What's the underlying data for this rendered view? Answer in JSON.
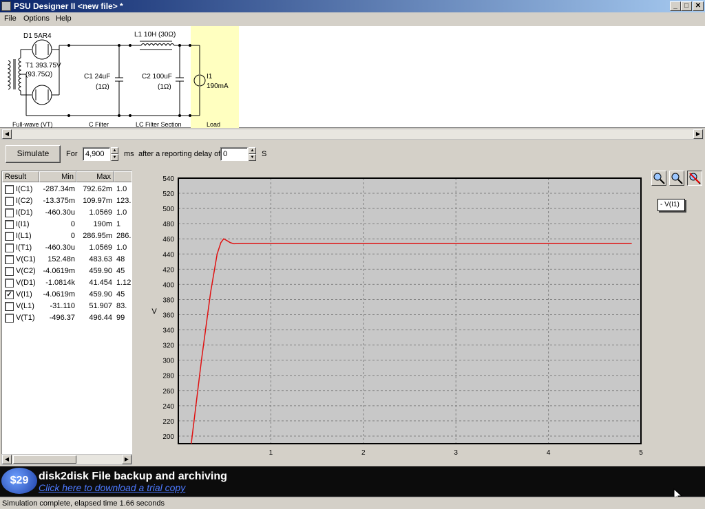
{
  "window": {
    "title": "PSU Designer II  <new file> *",
    "caption_buttons": {
      "minimize": "_",
      "maximize": "□",
      "close": "✕"
    }
  },
  "menu": {
    "items": [
      "File",
      "Options",
      "Help"
    ]
  },
  "schematic": {
    "d1": "D1 5AR4",
    "t1_a": "T1 393.75V",
    "t1_b": "(93.75Ω)",
    "l1": "L1 10H (30Ω)",
    "c1_a": "C1 24uF",
    "c1_b": "(1Ω)",
    "c2_a": "C2 100uF",
    "c2_b": "(1Ω)",
    "i1_a": "I1",
    "i1_b": "190mA",
    "sections": [
      "Full-wave (VT)",
      "C Filter",
      "LC Filter Section",
      "Load"
    ],
    "load_highlight": "#ffffc0"
  },
  "controls": {
    "simulate_label": "Simulate",
    "for_label": "For",
    "duration_value": "4,900",
    "duration_unit": "ms",
    "delay_label": "after a reporting delay of",
    "delay_value": "0",
    "delay_unit": "S"
  },
  "results": {
    "headers": [
      "Result",
      "Min",
      "Max"
    ],
    "rows": [
      {
        "name": "I(C1)",
        "min": "-287.34m",
        "max": "792.62m",
        "extra": "1.0",
        "checked": false
      },
      {
        "name": "I(C2)",
        "min": "-13.375m",
        "max": "109.97m",
        "extra": "123.",
        "checked": false
      },
      {
        "name": "I(D1)",
        "min": "-460.30u",
        "max": "1.0569",
        "extra": "1.0",
        "checked": false
      },
      {
        "name": "I(I1)",
        "min": "0",
        "max": "190m",
        "extra": "1",
        "checked": false
      },
      {
        "name": "I(L1)",
        "min": "0",
        "max": "286.95m",
        "extra": "286.",
        "checked": false
      },
      {
        "name": "I(T1)",
        "min": "-460.30u",
        "max": "1.0569",
        "extra": "1.0",
        "checked": false
      },
      {
        "name": "V(C1)",
        "min": "152.48n",
        "max": "483.63",
        "extra": "48",
        "checked": false
      },
      {
        "name": "V(C2)",
        "min": "-4.0619m",
        "max": "459.90",
        "extra": "45",
        "checked": false
      },
      {
        "name": "V(D1)",
        "min": "-1.0814k",
        "max": "41.454",
        "extra": "1.12",
        "checked": false
      },
      {
        "name": "V(I1)",
        "min": "-4.0619m",
        "max": "459.90",
        "extra": "45",
        "checked": true
      },
      {
        "name": "V(L1)",
        "min": "-31.110",
        "max": "51.907",
        "extra": "83.",
        "checked": false
      },
      {
        "name": "V(T1)",
        "min": "-496.37",
        "max": "496.44",
        "extra": "99",
        "checked": false
      }
    ]
  },
  "chart_data": {
    "type": "line",
    "ylabel": "V",
    "xlim": [
      0,
      5
    ],
    "ylim": [
      190,
      540
    ],
    "x_ticks": [
      1,
      2,
      3,
      4,
      5
    ],
    "y_ticks": [
      200,
      220,
      240,
      260,
      280,
      300,
      320,
      340,
      360,
      380,
      400,
      420,
      440,
      460,
      480,
      500,
      520,
      540
    ],
    "grid": true,
    "legend": "top-right",
    "series": [
      {
        "name": "V(I1)",
        "color": "#e01010",
        "x": [
          0.14,
          0.25,
          0.35,
          0.42,
          0.46,
          0.49,
          0.52,
          0.56,
          0.6,
          0.7,
          0.8,
          1.0,
          2.0,
          3.0,
          4.0,
          4.9
        ],
        "y": [
          190,
          300,
          390,
          440,
          455,
          460,
          458,
          455,
          453.5,
          454,
          454,
          454,
          454,
          454,
          454,
          454
        ]
      }
    ],
    "legend_label": "- V(I1)"
  },
  "banner": {
    "price": "$29",
    "headline": "disk2disk File backup and archiving",
    "link": "Click here to download a trial copy"
  },
  "status": {
    "text": "Simulation complete, elapsed time 1.66 seconds"
  }
}
